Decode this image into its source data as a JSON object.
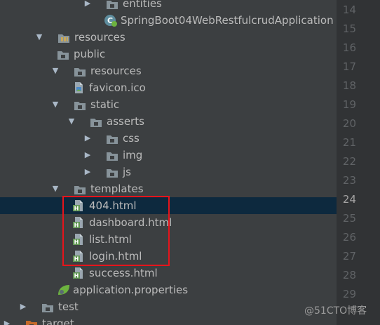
{
  "tree": {
    "items": [
      {
        "label": "entities",
        "icon": "folder-icon",
        "arrow": "expand-arrow-icon"
      },
      {
        "label": "SpringBoot04WebRestfulcrudApplication",
        "icon": "spring-boot-class-icon",
        "arrow": ""
      },
      {
        "label": "resources",
        "icon": "resources-root-folder-icon",
        "arrow": "collapse-arrow-icon"
      },
      {
        "label": "public",
        "icon": "folder-icon",
        "arrow": ""
      },
      {
        "label": "resources",
        "icon": "folder-icon",
        "arrow": "collapse-arrow-icon"
      },
      {
        "label": "favicon.ico",
        "icon": "image-file-icon",
        "arrow": ""
      },
      {
        "label": "static",
        "icon": "folder-icon",
        "arrow": "collapse-arrow-icon"
      },
      {
        "label": "asserts",
        "icon": "folder-icon",
        "arrow": "collapse-arrow-icon"
      },
      {
        "label": "css",
        "icon": "folder-icon",
        "arrow": "expand-arrow-icon"
      },
      {
        "label": "img",
        "icon": "folder-icon",
        "arrow": "expand-arrow-icon"
      },
      {
        "label": "js",
        "icon": "folder-icon",
        "arrow": "expand-arrow-icon"
      },
      {
        "label": "templates",
        "icon": "folder-icon",
        "arrow": "collapse-arrow-icon"
      },
      {
        "label": "404.html",
        "icon": "html-file-icon",
        "arrow": "",
        "selected": true
      },
      {
        "label": "dashboard.html",
        "icon": "html-file-icon",
        "arrow": ""
      },
      {
        "label": "list.html",
        "icon": "html-file-icon",
        "arrow": ""
      },
      {
        "label": "login.html",
        "icon": "html-file-icon",
        "arrow": ""
      },
      {
        "label": "success.html",
        "icon": "html-file-icon",
        "arrow": ""
      },
      {
        "label": "application.properties",
        "icon": "spring-properties-icon",
        "arrow": ""
      },
      {
        "label": "test",
        "icon": "folder-icon",
        "arrow": "expand-arrow-icon"
      },
      {
        "label": "target",
        "icon": "excluded-folder-icon",
        "arrow": "expand-arrow-icon"
      }
    ]
  },
  "gutter": {
    "line_numbers": [
      "14",
      "15",
      "16",
      "17",
      "18",
      "19",
      "20",
      "21",
      "22",
      "23",
      "24",
      "25",
      "26",
      "27",
      "28",
      "29"
    ],
    "current_line": "24"
  },
  "watermark": {
    "text": "@51CTO博客"
  },
  "colors": {
    "tree_background": "#3c3f41",
    "gutter_background": "#313335",
    "selection": "#0d293e",
    "highlight_border": "#e6141b",
    "folder": "#87939a",
    "html_badge": "#629755"
  }
}
